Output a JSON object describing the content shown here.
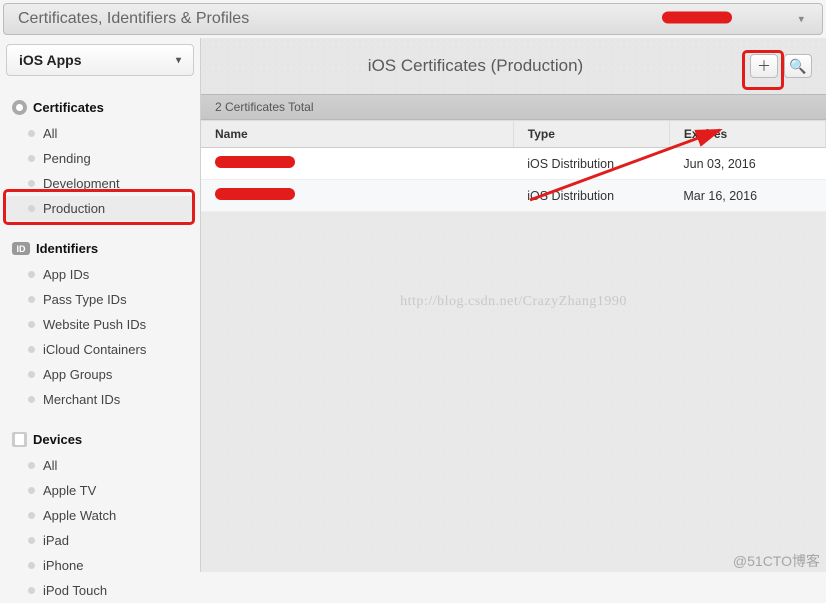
{
  "header": {
    "title": "Certificates, Identifiers & Profiles"
  },
  "sidebar": {
    "selector_label": "iOS Apps",
    "sections": [
      {
        "label": "Certificates",
        "items": [
          "All",
          "Pending",
          "Development",
          "Production"
        ],
        "selected": 3
      },
      {
        "label": "Identifiers",
        "items": [
          "App IDs",
          "Pass Type IDs",
          "Website Push IDs",
          "iCloud Containers",
          "App Groups",
          "Merchant IDs"
        ],
        "selected": -1
      },
      {
        "label": "Devices",
        "items": [
          "All",
          "Apple TV",
          "Apple Watch",
          "iPad",
          "iPhone",
          "iPod Touch"
        ],
        "selected": -1
      }
    ]
  },
  "content": {
    "title": "iOS Certificates (Production)",
    "total_label": "2 Certificates Total",
    "columns": [
      "Name",
      "Type",
      "Expires"
    ],
    "rows": [
      {
        "name": "(redacted)",
        "type": "iOS Distribution",
        "expires": "Jun 03, 2016"
      },
      {
        "name": "(redacted)",
        "type": "iOS Distribution",
        "expires": "Mar 16, 2016"
      }
    ]
  },
  "watermarks": {
    "center": "http://blog.csdn.net/CrazyZhang1990",
    "bottom_right": "@51CTO博客"
  }
}
